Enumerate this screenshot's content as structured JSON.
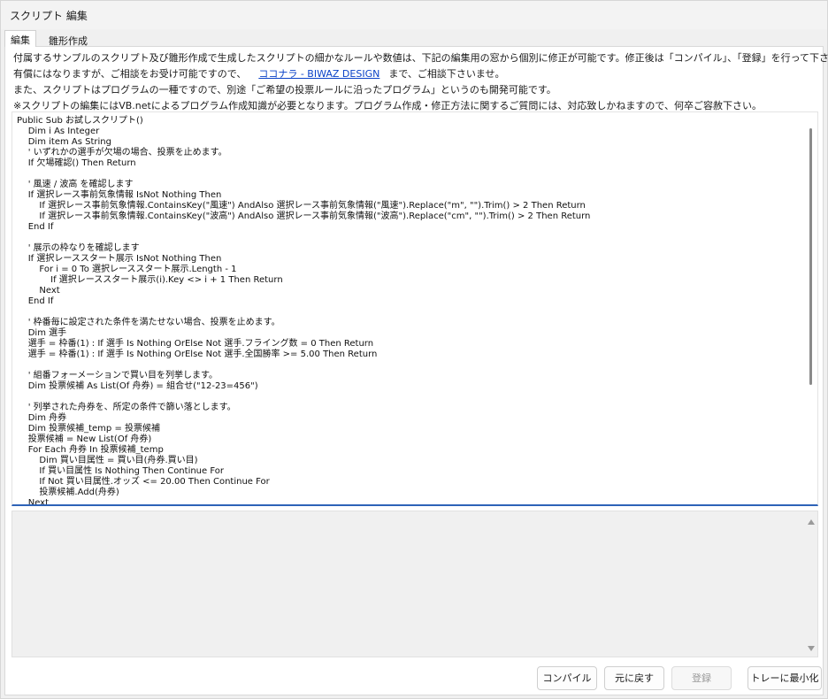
{
  "window": {
    "title": "スクリプト 編集"
  },
  "tabs": [
    {
      "label": "編集"
    },
    {
      "label": "雛形作成"
    }
  ],
  "notes": {
    "line1": "付属するサンプルのスクリプト及び雛形作成で生成したスクリプトの細かなルールや数値は、下記の編集用の窓から個別に修正が可能です。修正後は「コンパイル」、「登録」を行って下さい。",
    "line2_prefix": "有償にはなりますが、ご相談をお受け可能ですので、",
    "line2_link": "ココナラ - BIWAZ DESIGN",
    "line2_suffix": "まで、ご相談下さいませ。",
    "line3": "また、スクリプトはプログラムの一種ですので、別途「ご希望の投票ルールに沿ったプログラム」というのも開発可能です。",
    "line4": "※スクリプトの編集にはVB.netによるプログラム作成知識が必要となります。プログラム作成・修正方法に関するご質問には、対応致しかねますので、何卒ご容赦下さい。"
  },
  "editor": {
    "code": "Public Sub お試しスクリプト()\n    Dim i As Integer\n    Dim item As String\n    ' いずれかの選手が欠場の場合、投票を止めます。\n    If 欠場確認() Then Return\n\n    ' 風速 / 波高 を確認します\n    If 選択レース事前気象情報 IsNot Nothing Then\n        If 選択レース事前気象情報.ContainsKey(\"風速\") AndAlso 選択レース事前気象情報(\"風速\").Replace(\"m\", \"\").Trim() > 2 Then Return\n        If 選択レース事前気象情報.ContainsKey(\"波高\") AndAlso 選択レース事前気象情報(\"波高\").Replace(\"cm\", \"\").Trim() > 2 Then Return\n    End If\n\n    ' 展示の枠なりを確認します\n    If 選択レーススタート展示 IsNot Nothing Then\n        For i = 0 To 選択レーススタート展示.Length - 1\n            If 選択レーススタート展示(i).Key <> i + 1 Then Return\n        Next\n    End If\n\n    ' 枠番毎に設定された条件を満たせない場合、投票を止めます。\n    Dim 選手\n    選手 = 枠番(1) : If 選手 Is Nothing OrElse Not 選手.フライング数 = 0 Then Return\n    選手 = 枠番(1) : If 選手 Is Nothing OrElse Not 選手.全国勝率 >= 5.00 Then Return\n\n    ' 組番フォーメーションで買い目を列挙します。\n    Dim 投票候補 As List(Of 舟券) = 組合せ(\"12-23=456\")\n\n    ' 列挙された舟券を、所定の条件で篩い落とします。\n    Dim 舟券\n    Dim 投票候補_temp = 投票候補\n    投票候補 = New List(Of 舟券)\n    For Each 舟券 In 投票候補_temp\n        Dim 買い目属性 = 買い目(舟券.買い目)\n        If 買い目属性 Is Nothing Then Continue For\n        If Not 買い目属性.オッズ <= 20.00 Then Continue For\n        投票候補.Add(舟券)\n    Next"
  },
  "buttons": {
    "compile": "コンパイル",
    "undo": "元に戻す",
    "register": "登録",
    "tray": "トレーに最小化"
  }
}
